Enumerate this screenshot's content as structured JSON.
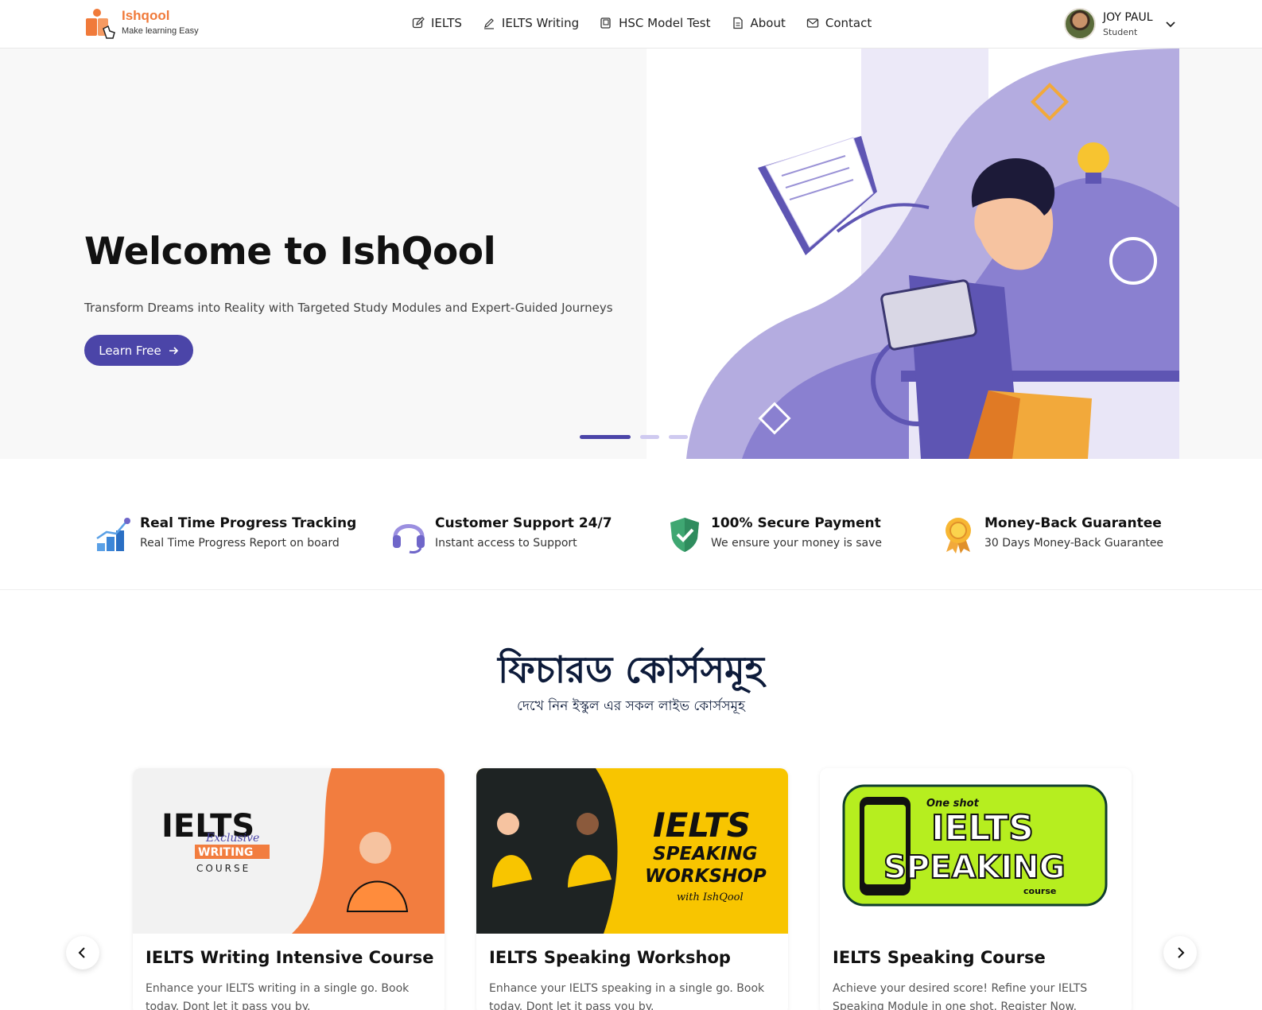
{
  "brand": {
    "name": "Ishqool",
    "tagline": "Make learning Easy",
    "accent": "#f07a3a"
  },
  "nav": {
    "items": [
      {
        "label": "IELTS",
        "icon": "edit-icon"
      },
      {
        "label": "IELTS Writing",
        "icon": "pen-icon"
      },
      {
        "label": "HSC Model Test",
        "icon": "book-icon"
      },
      {
        "label": "About",
        "icon": "document-icon"
      },
      {
        "label": "Contact",
        "icon": "mail-icon"
      }
    ]
  },
  "user": {
    "name": "JOY PAUL",
    "role": "Student"
  },
  "hero": {
    "title": "Welcome to IshQool",
    "subtitle": "Transform Dreams into Reality with Targeted Study Modules and Expert-Guided Journeys",
    "cta_label": "Learn Free",
    "primary_color": "#4b45a8",
    "slides_total": 3,
    "active_slide": 1
  },
  "features": [
    {
      "title": "Real Time Progress Tracking",
      "desc": "Real Time Progress Report on board",
      "icon": "progress-chart-icon"
    },
    {
      "title": "Customer Support 24/7",
      "desc": "Instant access to Support",
      "icon": "headset-icon"
    },
    {
      "title": "100% Secure Payment",
      "desc": "We ensure your money is save",
      "icon": "shield-check-icon"
    },
    {
      "title": "Money-Back Guarantee",
      "desc": "30 Days Money-Back Guarantee",
      "icon": "award-badge-icon"
    }
  ],
  "courses_section": {
    "title": "ফিচারড কোর্সসমূহ",
    "subtitle": "দেখে নিন ইস্কুল এর সকল লাইভ কোর্সসমূহ"
  },
  "courses": [
    {
      "title": "IELTS Writing Intensive Course",
      "desc": "Enhance your IELTS writing in a single go. Book today. Dont let it pass you by.",
      "banner": {
        "line1": "IELTS",
        "line2": "Exclusive",
        "line3": "WRITING",
        "line4": "COURSE"
      }
    },
    {
      "title": "IELTS Speaking Workshop",
      "desc": "Enhance your IELTS speaking in a single go. Book today. Dont let it pass you by.",
      "banner": {
        "line1": "IELTS",
        "line2": "SPEAKING",
        "line3": "WORKSHOP",
        "line4": "with IshQool"
      }
    },
    {
      "title": "IELTS Speaking Course",
      "desc": "Achieve your desired score! Refine your IELTS Speaking Module in one shot. Register Now.",
      "banner": {
        "line1": "One shot",
        "line2": "IELTS",
        "line3": "SPEAKING",
        "line4": "course"
      }
    }
  ]
}
